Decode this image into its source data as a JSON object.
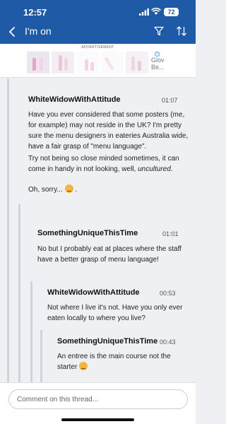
{
  "status": {
    "time": "12:57",
    "battery": "72"
  },
  "nav": {
    "title": "I'm on",
    "back_icon": "chevron-left-icon",
    "filter_icon": "filter-icon",
    "sort_icon": "sort-icon"
  },
  "ad": {
    "label": "ADVERTISEMENT",
    "brand_text_1": "Glov",
    "brand_text_2": "Be..."
  },
  "comments": [
    {
      "author": "WhiteWidowWithAttitude",
      "time": "01:07",
      "para1": "Have you ever considered that some posters (me, for example) may not reside in the UK? I'm pretty sure the menu designers in eateries Australia wide, have a fair grasp of \"menu language\".",
      "para2a": "Try not being so close minded sometimes, it can come in handy in not looking, well,",
      "para2b": "uncultured",
      "para2c": ".",
      "para3": "Oh, sorry..."
    },
    {
      "author": "SomethingUniqueThisTime",
      "time": "01:01",
      "para1": "No but I probably eat at places where the staff have a better grasp of menu language!"
    },
    {
      "author": "WhiteWidowWithAttitude",
      "time": "00:53",
      "para1": "Not where I live it's not. Have you only ever eaten locally to where you live?"
    },
    {
      "author": "SomethingUniqueThisTime",
      "time": "00:43",
      "para1": "An entree is the main course not the starter"
    }
  ],
  "composer": {
    "placeholder": "Comment on this thread..."
  },
  "colors": {
    "header": "#1f5aa6",
    "thread_bg": "#eef0f3",
    "line": "#d0d4da"
  }
}
